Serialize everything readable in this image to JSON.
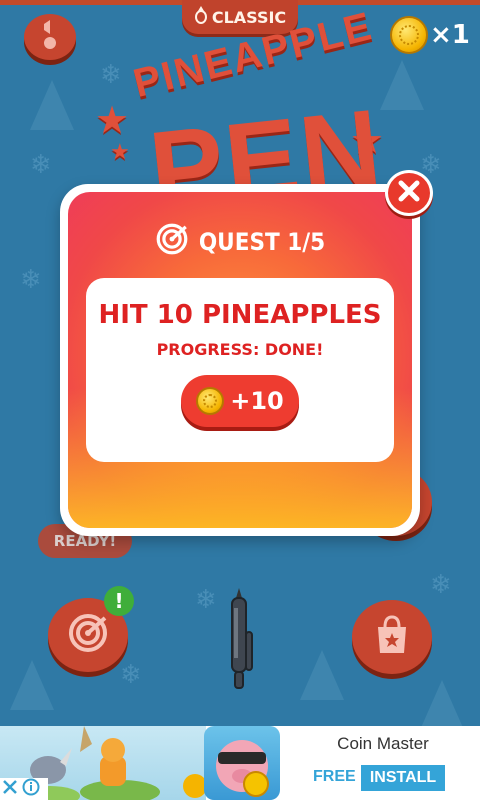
{
  "header": {
    "mode_label": "CLASSIC",
    "coin_count": "×1"
  },
  "logo": {
    "line1": "PINEAPPLE",
    "line2": "PEN"
  },
  "menu": {
    "ready_label": "READY!",
    "notification_badge": "!"
  },
  "quest_modal": {
    "title": "QUEST 1/5",
    "task": "HIT 10 PINEAPPLES",
    "progress": "PROGRESS: DONE!",
    "reward": "+10"
  },
  "ad_banner": {
    "title": "Coin Master",
    "free_label": "FREE",
    "install_label": "INSTALL"
  },
  "colors": {
    "background": "#2f79a5",
    "accent_red": "#c6452f",
    "modal_gradient_top": "#ef3d58",
    "modal_gradient_bottom": "#ffc21e",
    "quest_text_red": "#de2222",
    "ad_blue": "#34a4d8"
  }
}
